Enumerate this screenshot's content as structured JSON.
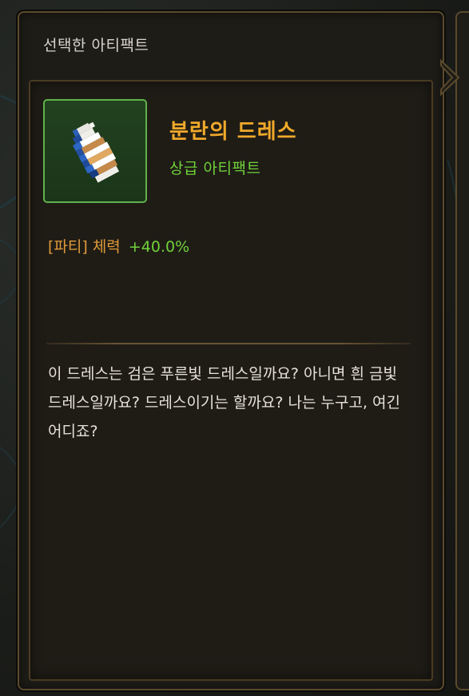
{
  "panel": {
    "title": "선택한 아티팩트"
  },
  "artifact": {
    "name": "분란의 드레스",
    "grade": "상급 아티팩트",
    "icon": "dress-artifact-icon",
    "stat": {
      "label": "[파티] 체력",
      "value": "+40.0%"
    },
    "description": "이 드레스는 검은 푸른빛 드레스일까요? 아니면 흰 금빛 드레스일까요? 드레스이기는 할까요? 나는 누구고, 여긴 어디죠?"
  },
  "colors": {
    "name": "#f0a92a",
    "grade": "#6fd23a",
    "stat_label": "#e09a3a",
    "stat_value": "#6fd23a",
    "frame_border": "#5a4a2c",
    "item_frame_border": "#5fb24a"
  }
}
